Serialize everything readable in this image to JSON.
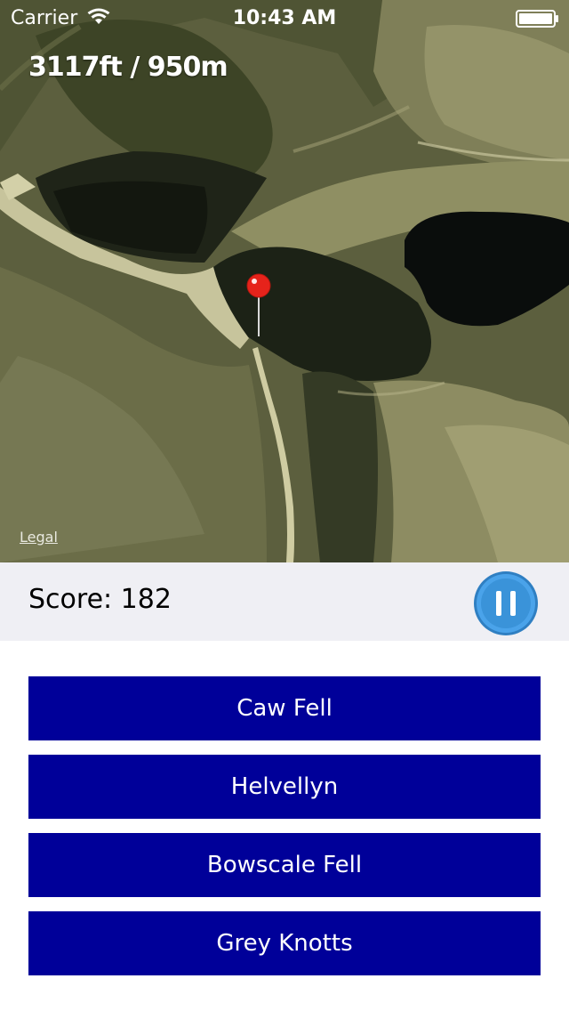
{
  "status_bar": {
    "carrier": "Carrier",
    "time": "10:43 AM",
    "wifi_icon": "wifi-icon",
    "battery_icon": "battery-icon"
  },
  "map": {
    "altitude": "3117ft / 950m",
    "legal_label": "Legal",
    "pin_icon": "map-pin-icon",
    "pin_color": "#e6231b"
  },
  "score_bar": {
    "score_text": "Score: 182",
    "pause_icon": "pause-icon",
    "pause_color": "#3a93d9"
  },
  "answers": [
    {
      "label": "Caw Fell"
    },
    {
      "label": "Helvellyn"
    },
    {
      "label": "Bowscale Fell"
    },
    {
      "label": "Grey Knotts"
    }
  ],
  "colors": {
    "answer_button_bg": "#000099",
    "answer_button_text": "#ffffff",
    "score_bar_bg": "#efeff4"
  }
}
